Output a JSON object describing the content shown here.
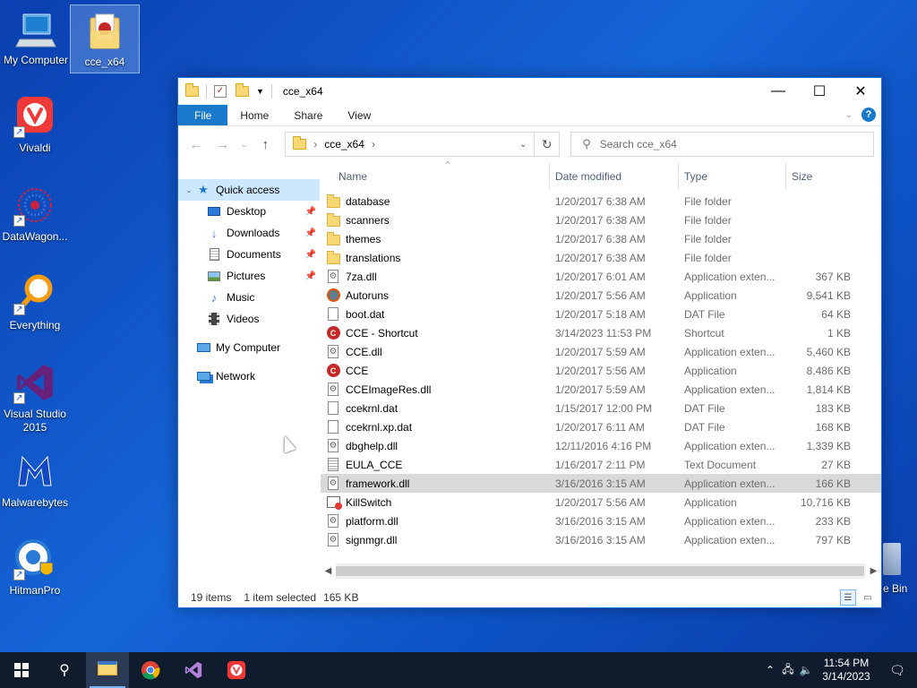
{
  "desktop": {
    "icons": [
      {
        "label": "My Computer",
        "icon": "computer-icon"
      },
      {
        "label": "cce_x64",
        "icon": "folder-icon"
      },
      {
        "label": "Vivaldi",
        "icon": "vivaldi-icon"
      },
      {
        "label": "DataWagon...",
        "icon": "datawagon-icon"
      },
      {
        "label": "Everything",
        "icon": "everything-icon"
      },
      {
        "label": "Visual Studio 2015",
        "icon": "visual-studio-icon"
      },
      {
        "label": "Malwarebytes",
        "icon": "malwarebytes-icon"
      },
      {
        "label": "HitmanPro",
        "icon": "hitmanpro-icon"
      }
    ],
    "recycle_bin_partial": "e Bin"
  },
  "window": {
    "title": "cce_x64",
    "tabs": [
      "File",
      "Home",
      "Share",
      "View"
    ],
    "address": {
      "crumbs": [
        "cce_x64"
      ]
    },
    "search": {
      "placeholder": "Search cce_x64"
    },
    "nav": {
      "quick_access": "Quick access",
      "items": [
        {
          "label": "Desktop",
          "icon": "desktop-icon",
          "pinned": true
        },
        {
          "label": "Downloads",
          "icon": "download-arrow-icon",
          "pinned": true
        },
        {
          "label": "Documents",
          "icon": "documents-icon",
          "pinned": true
        },
        {
          "label": "Pictures",
          "icon": "pictures-icon",
          "pinned": true
        },
        {
          "label": "Music",
          "icon": "music-note-icon",
          "pinned": false
        },
        {
          "label": "Videos",
          "icon": "film-icon",
          "pinned": false
        }
      ],
      "my_computer": "My Computer",
      "network": "Network"
    },
    "columns": {
      "name": "Name",
      "date": "Date modified",
      "type": "Type",
      "size": "Size"
    },
    "files": [
      {
        "name": "database",
        "date": "1/20/2017 6:38 AM",
        "type": "File folder",
        "size": "",
        "icon": "folder"
      },
      {
        "name": "scanners",
        "date": "1/20/2017 6:38 AM",
        "type": "File folder",
        "size": "",
        "icon": "folder"
      },
      {
        "name": "themes",
        "date": "1/20/2017 6:38 AM",
        "type": "File folder",
        "size": "",
        "icon": "folder"
      },
      {
        "name": "translations",
        "date": "1/20/2017 6:38 AM",
        "type": "File folder",
        "size": "",
        "icon": "folder"
      },
      {
        "name": "7za.dll",
        "date": "1/20/2017 6:01 AM",
        "type": "Application exten...",
        "size": "367 KB",
        "icon": "dll"
      },
      {
        "name": "Autoruns",
        "date": "1/20/2017 5:56 AM",
        "type": "Application",
        "size": "9,541 KB",
        "icon": "gear"
      },
      {
        "name": "boot.dat",
        "date": "1/20/2017 5:18 AM",
        "type": "DAT File",
        "size": "64 KB",
        "icon": "doc"
      },
      {
        "name": "CCE - Shortcut",
        "date": "3/14/2023 11:53 PM",
        "type": "Shortcut",
        "size": "1 KB",
        "icon": "red"
      },
      {
        "name": "CCE.dll",
        "date": "1/20/2017 5:59 AM",
        "type": "Application exten...",
        "size": "5,460 KB",
        "icon": "dll"
      },
      {
        "name": "CCE",
        "date": "1/20/2017 5:56 AM",
        "type": "Application",
        "size": "8,486 KB",
        "icon": "red"
      },
      {
        "name": "CCEImageRes.dll",
        "date": "1/20/2017 5:59 AM",
        "type": "Application exten...",
        "size": "1,814 KB",
        "icon": "dll"
      },
      {
        "name": "ccekrnl.dat",
        "date": "1/15/2017 12:00 PM",
        "type": "DAT File",
        "size": "183 KB",
        "icon": "doc"
      },
      {
        "name": "ccekrnl.xp.dat",
        "date": "1/20/2017 6:11 AM",
        "type": "DAT File",
        "size": "168 KB",
        "icon": "doc"
      },
      {
        "name": "dbghelp.dll",
        "date": "12/11/2016 4:16 PM",
        "type": "Application exten...",
        "size": "1,339 KB",
        "icon": "dll"
      },
      {
        "name": "EULA_CCE",
        "date": "1/16/2017 2:11 PM",
        "type": "Text Document",
        "size": "27 KB",
        "icon": "txt"
      },
      {
        "name": "framework.dll",
        "date": "3/16/2016 3:15 AM",
        "type": "Application exten...",
        "size": "166 KB",
        "icon": "dll",
        "selected": true
      },
      {
        "name": "KillSwitch",
        "date": "1/20/2017 5:56 AM",
        "type": "Application",
        "size": "10,716 KB",
        "icon": "kill"
      },
      {
        "name": "platform.dll",
        "date": "3/16/2016 3:15 AM",
        "type": "Application exten...",
        "size": "233 KB",
        "icon": "dll"
      },
      {
        "name": "signmgr.dll",
        "date": "3/16/2016 3:15 AM",
        "type": "Application exten...",
        "size": "797 KB",
        "icon": "dll"
      }
    ],
    "status": {
      "count": "19 items",
      "selected": "1 item selected",
      "size": "165 KB"
    }
  },
  "taskbar": {
    "apps": [
      "start-icon",
      "search-icon",
      "file-explorer-icon",
      "chrome-icon",
      "visual-studio-icon",
      "vivaldi-icon"
    ],
    "time": "11:54 PM",
    "date": "3/14/2023"
  },
  "colors": {
    "accent": "#1979ca",
    "selection": "#cce8ff",
    "row_selected": "#d9d9d9",
    "taskbar": "#101b2e"
  }
}
